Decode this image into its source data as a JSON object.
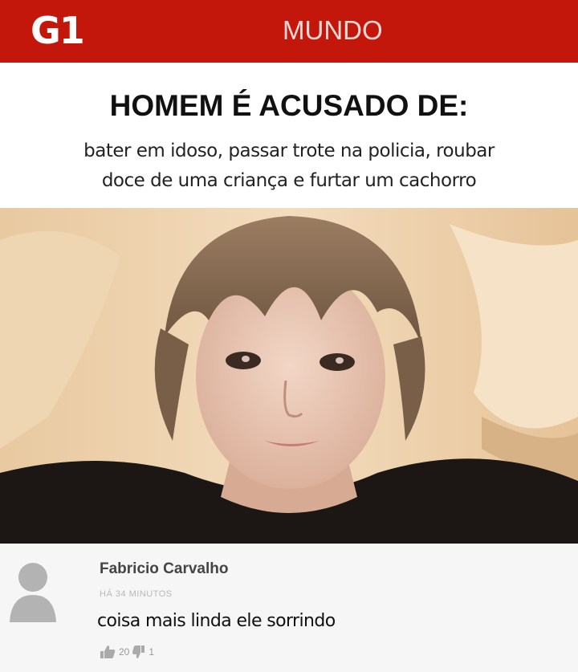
{
  "header": {
    "logo": "G1",
    "section": "MUNDO",
    "bg_color": "#c4170c"
  },
  "article": {
    "headline": "HOMEM É ACUSADO DE:",
    "subtitle_line1": "bater em idoso, passar trote na policia, roubar",
    "subtitle_line2": "doce de uma criança e furtar um cachorro"
  },
  "photo": {
    "icon": "selfie-photo"
  },
  "comment": {
    "author": "Fabricio Carvalho",
    "time": "HÁ 34 MINUTOS",
    "text": "coisa mais linda ele sorrindo",
    "likes": "20",
    "dislikes": "1",
    "avatar_icon": "user-avatar-icon"
  }
}
